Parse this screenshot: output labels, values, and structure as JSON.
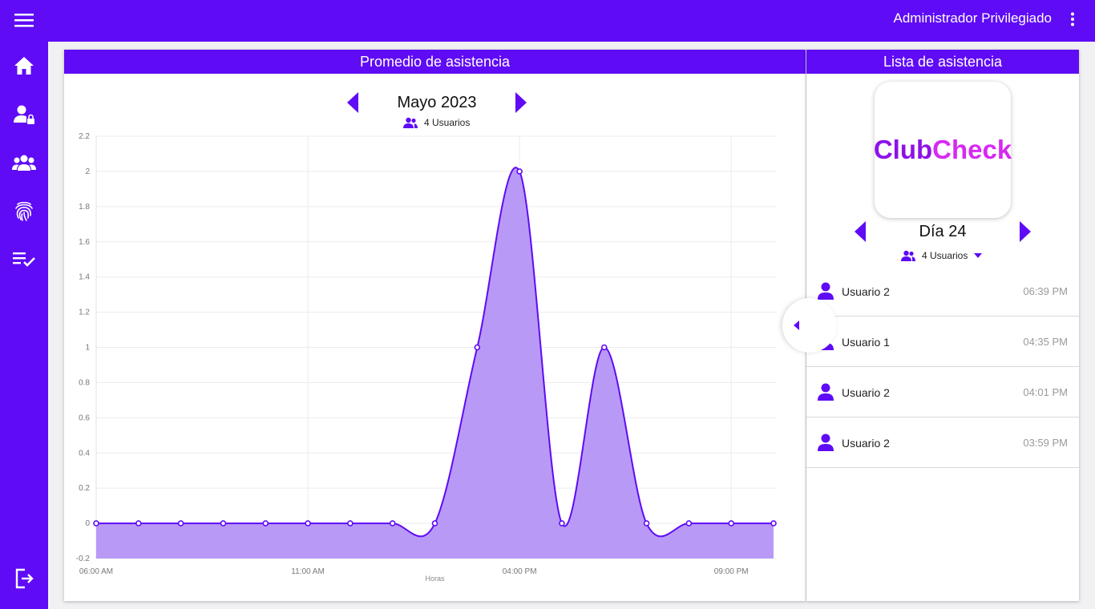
{
  "app": {
    "user_name": "Administrador Privilegiado",
    "accent_color": "#5f0bf5"
  },
  "sidebar": {
    "items": [
      {
        "icon": "menu-icon"
      },
      {
        "icon": "home-icon"
      },
      {
        "icon": "user-lock-icon"
      },
      {
        "icon": "users-group-icon"
      },
      {
        "icon": "fingerprint-icon"
      },
      {
        "icon": "checklist-icon"
      },
      {
        "icon": "logout-icon"
      }
    ]
  },
  "left_panel": {
    "title": "Promedio de asistencia",
    "month_label": "Mayo 2023",
    "users_label": "4 Usuarios"
  },
  "right_panel": {
    "title": "Lista de asistencia",
    "logo_part1": "Club",
    "logo_part2": "Check",
    "day_label": "Día 24",
    "users_label": "4 Usuarios",
    "attendance": [
      {
        "name": "Usuario 2",
        "time": "06:39 PM"
      },
      {
        "name": "Usuario 1",
        "time": "04:35 PM"
      },
      {
        "name": "Usuario 2",
        "time": "04:01 PM"
      },
      {
        "name": "Usuario 2",
        "time": "03:59 PM"
      }
    ]
  },
  "chart_data": {
    "type": "area",
    "x": [
      "06:00 AM",
      "07:00 AM",
      "08:00 AM",
      "09:00 AM",
      "10:00 AM",
      "11:00 AM",
      "12:00 PM",
      "01:00 PM",
      "02:00 PM",
      "03:00 PM",
      "04:00 PM",
      "05:00 PM",
      "06:00 PM",
      "07:00 PM",
      "08:00 PM",
      "09:00 PM",
      "10:00 PM"
    ],
    "values": [
      0,
      0,
      0,
      0,
      0,
      0,
      0,
      0,
      0,
      1,
      2,
      0,
      1,
      0,
      0,
      0,
      0
    ],
    "x_tick_labels": [
      "06:00 AM",
      "11:00 AM",
      "04:00 PM",
      "09:00 PM"
    ],
    "x_tick_indices": [
      0,
      5,
      10,
      15
    ],
    "xlabel": "Horas",
    "ylim": [
      -0.2,
      2.2
    ],
    "y_ticks": [
      "-0.2",
      "0",
      "0.2",
      "0.4",
      "0.6",
      "0.8",
      "1",
      "1.2",
      "1.4",
      "1.6",
      "1.8",
      "2",
      "2.2"
    ],
    "line_color": "#5f0bf5",
    "fill_color": "#b89af6",
    "grid": true
  }
}
